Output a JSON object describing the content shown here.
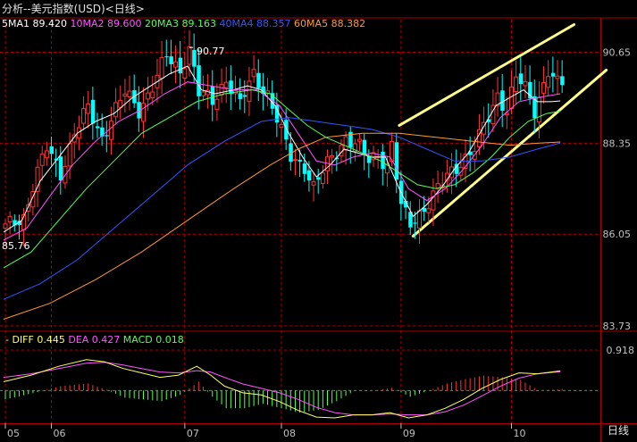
{
  "header": {
    "title": "分析--美元指数(USD)<日线>"
  },
  "ma_legend": [
    {
      "label": "5MA1",
      "value": "89.420",
      "color": "#ffffff"
    },
    {
      "label": "10MA2",
      "value": "89.600",
      "color": "#ff55ff"
    },
    {
      "label": "20MA3",
      "value": "89.163",
      "color": "#55ff55"
    },
    {
      "label": "40MA4",
      "value": "88.357",
      "color": "#3355ff"
    },
    {
      "label": "60MA5",
      "value": "88.382",
      "color": "#ff9933"
    }
  ],
  "macd_legend": [
    {
      "label": "DIFF",
      "value": "0.445",
      "color": "#ffff66"
    },
    {
      "label": "DEA",
      "value": "0.427",
      "color": "#ff55ff"
    },
    {
      "label": "MACD",
      "value": "0.018",
      "color": "#55ff55"
    }
  ],
  "period_label": "日线",
  "colors": {
    "up": "#ff3333",
    "down": "#00ffff",
    "grid": "#aa0000",
    "axis_text": "#c0c0c0",
    "trendline": "#ffff88"
  },
  "chart_data": [
    {
      "type": "candlestick",
      "name": "price",
      "ylim": [
        83.73,
        91.0
      ],
      "y_ticks": [
        "90.65",
        "88.35",
        "86.05",
        "83.73"
      ],
      "y_tick_values": [
        90.65,
        88.35,
        86.05,
        83.73
      ],
      "x_ticks": [
        "05",
        "06",
        "07",
        "08",
        "09",
        "10"
      ],
      "x_tick_index": [
        0,
        10,
        39,
        60,
        86,
        110
      ],
      "annotations": [
        {
          "text": "90.77",
          "index": 40,
          "value": 90.77
        },
        {
          "text": "85.76",
          "index": 0,
          "value": 85.76
        }
      ],
      "close_path": [
        [
          0,
          86.2
        ],
        [
          4,
          86.5
        ],
        [
          6,
          87.3
        ],
        [
          9,
          88.2
        ],
        [
          12,
          87.6
        ],
        [
          15,
          88.6
        ],
        [
          18,
          89.2
        ],
        [
          21,
          88.5
        ],
        [
          23,
          89.0
        ],
        [
          26,
          89.6
        ],
        [
          29,
          89.2
        ],
        [
          32,
          89.8
        ],
        [
          35,
          90.5
        ],
        [
          38,
          90.2
        ],
        [
          40,
          90.77
        ],
        [
          42,
          89.6
        ],
        [
          45,
          89.4
        ],
        [
          48,
          90.0
        ],
        [
          51,
          89.3
        ],
        [
          54,
          90.1
        ],
        [
          57,
          89.6
        ],
        [
          60,
          88.6
        ],
        [
          62,
          88.0
        ],
        [
          65,
          87.8
        ],
        [
          67,
          87.2
        ],
        [
          69,
          87.6
        ],
        [
          71,
          88.0
        ],
        [
          74,
          88.5
        ],
        [
          77,
          88.2
        ],
        [
          79,
          87.9
        ],
        [
          81,
          88.1
        ],
        [
          83,
          87.8
        ],
        [
          84,
          88.3
        ],
        [
          86,
          86.7
        ],
        [
          88,
          86.3
        ],
        [
          90,
          86.6
        ],
        [
          93,
          87.0
        ],
        [
          96,
          87.5
        ],
        [
          99,
          87.9
        ],
        [
          102,
          88.2
        ],
        [
          105,
          89.0
        ],
        [
          107,
          89.6
        ],
        [
          109,
          89.2
        ],
        [
          111,
          90.0
        ],
        [
          113,
          89.7
        ],
        [
          115,
          89.2
        ],
        [
          118,
          90.2
        ],
        [
          120,
          89.8
        ]
      ],
      "ma_series": [
        {
          "name": "5MA1",
          "color": "#ffffff",
          "values": [
            [
              0,
              86.1
            ],
            [
              4,
              86.4
            ],
            [
              8,
              87.4
            ],
            [
              12,
              88.0
            ],
            [
              16,
              88.6
            ],
            [
              20,
              88.9
            ],
            [
              24,
              89.1
            ],
            [
              28,
              89.5
            ],
            [
              32,
              89.8
            ],
            [
              36,
              90.1
            ],
            [
              40,
              90.3
            ],
            [
              43,
              89.7
            ],
            [
              46,
              89.6
            ],
            [
              50,
              89.7
            ],
            [
              53,
              89.8
            ],
            [
              56,
              89.7
            ],
            [
              59,
              89.3
            ],
            [
              62,
              88.6
            ],
            [
              65,
              88.0
            ],
            [
              68,
              87.5
            ],
            [
              71,
              87.8
            ],
            [
              74,
              88.2
            ],
            [
              77,
              88.1
            ],
            [
              80,
              88.0
            ],
            [
              83,
              88.0
            ],
            [
              86,
              87.2
            ],
            [
              89,
              86.5
            ],
            [
              92,
              86.8
            ],
            [
              95,
              87.2
            ],
            [
              98,
              87.7
            ],
            [
              101,
              88.1
            ],
            [
              104,
              88.7
            ],
            [
              107,
              89.3
            ],
            [
              110,
              89.5
            ],
            [
              113,
              89.7
            ],
            [
              116,
              89.4
            ],
            [
              119,
              89.4
            ],
            [
              121,
              89.42
            ]
          ]
        },
        {
          "name": "10MA2",
          "color": "#ff55ff",
          "values": [
            [
              0,
              85.9
            ],
            [
              5,
              86.2
            ],
            [
              10,
              87.0
            ],
            [
              15,
              87.8
            ],
            [
              20,
              88.4
            ],
            [
              25,
              88.9
            ],
            [
              30,
              89.2
            ],
            [
              35,
              89.6
            ],
            [
              40,
              89.9
            ],
            [
              45,
              89.8
            ],
            [
              50,
              89.7
            ],
            [
              55,
              89.7
            ],
            [
              60,
              89.3
            ],
            [
              64,
              88.6
            ],
            [
              68,
              87.9
            ],
            [
              72,
              87.8
            ],
            [
              76,
              88.0
            ],
            [
              80,
              88.1
            ],
            [
              84,
              88.0
            ],
            [
              88,
              87.2
            ],
            [
              92,
              86.9
            ],
            [
              96,
              87.2
            ],
            [
              100,
              87.7
            ],
            [
              104,
              88.3
            ],
            [
              108,
              89.0
            ],
            [
              112,
              89.4
            ],
            [
              116,
              89.5
            ],
            [
              121,
              89.6
            ]
          ]
        },
        {
          "name": "20MA3",
          "color": "#55ff55",
          "values": [
            [
              0,
              85.2
            ],
            [
              6,
              85.6
            ],
            [
              12,
              86.4
            ],
            [
              18,
              87.2
            ],
            [
              24,
              87.9
            ],
            [
              30,
              88.6
            ],
            [
              36,
              89.0
            ],
            [
              42,
              89.4
            ],
            [
              48,
              89.6
            ],
            [
              54,
              89.7
            ],
            [
              58,
              89.6
            ],
            [
              62,
              89.2
            ],
            [
              66,
              88.8
            ],
            [
              70,
              88.5
            ],
            [
              74,
              88.3
            ],
            [
              78,
              88.1
            ],
            [
              82,
              87.9
            ],
            [
              86,
              87.6
            ],
            [
              90,
              87.3
            ],
            [
              94,
              87.2
            ],
            [
              98,
              87.3
            ],
            [
              102,
              87.6
            ],
            [
              106,
              88.0
            ],
            [
              110,
              88.5
            ],
            [
              114,
              88.9
            ],
            [
              118,
              89.1
            ],
            [
              121,
              89.163
            ]
          ]
        },
        {
          "name": "40MA4",
          "color": "#3355ff",
          "values": [
            [
              0,
              84.4
            ],
            [
              8,
              84.8
            ],
            [
              16,
              85.4
            ],
            [
              24,
              86.2
            ],
            [
              32,
              87.0
            ],
            [
              40,
              87.8
            ],
            [
              48,
              88.4
            ],
            [
              56,
              88.9
            ],
            [
              62,
              89.0
            ],
            [
              68,
              88.9
            ],
            [
              74,
              88.8
            ],
            [
              80,
              88.7
            ],
            [
              86,
              88.5
            ],
            [
              92,
              88.2
            ],
            [
              98,
              87.9
            ],
            [
              104,
              87.9
            ],
            [
              110,
              88.0
            ],
            [
              116,
              88.2
            ],
            [
              121,
              88.357
            ]
          ]
        },
        {
          "name": "60MA5",
          "color": "#ff9933",
          "values": [
            [
              0,
              83.9
            ],
            [
              10,
              84.3
            ],
            [
              20,
              84.9
            ],
            [
              30,
              85.6
            ],
            [
              40,
              86.4
            ],
            [
              50,
              87.2
            ],
            [
              58,
              87.8
            ],
            [
              64,
              88.2
            ],
            [
              70,
              88.5
            ],
            [
              78,
              88.6
            ],
            [
              86,
              88.6
            ],
            [
              94,
              88.5
            ],
            [
              102,
              88.4
            ],
            [
              110,
              88.3
            ],
            [
              116,
              88.35
            ],
            [
              121,
              88.382
            ]
          ]
        }
      ],
      "trendlines": [
        {
          "from": [
            86,
            88.8
          ],
          "to": [
            124,
            91.35
          ]
        },
        {
          "from": [
            89,
            86.0
          ],
          "to": [
            131,
            90.2
          ]
        }
      ]
    },
    {
      "type": "macd",
      "name": "macd",
      "ylim": [
        -0.7,
        0.918
      ],
      "y_ticks": [
        "0.918"
      ],
      "y_tick_values": [
        0.918
      ],
      "diff": [
        [
          0,
          0.2
        ],
        [
          6,
          0.35
        ],
        [
          12,
          0.55
        ],
        [
          18,
          0.7
        ],
        [
          22,
          0.65
        ],
        [
          26,
          0.5
        ],
        [
          30,
          0.4
        ],
        [
          34,
          0.3
        ],
        [
          38,
          0.35
        ],
        [
          42,
          0.55
        ],
        [
          45,
          0.35
        ],
        [
          48,
          0.1
        ],
        [
          52,
          -0.05
        ],
        [
          56,
          -0.1
        ],
        [
          60,
          -0.25
        ],
        [
          64,
          -0.45
        ],
        [
          68,
          -0.6
        ],
        [
          72,
          -0.62
        ],
        [
          76,
          -0.55
        ],
        [
          80,
          -0.55
        ],
        [
          84,
          -0.5
        ],
        [
          88,
          -0.62
        ],
        [
          92,
          -0.55
        ],
        [
          96,
          -0.4
        ],
        [
          100,
          -0.2
        ],
        [
          104,
          0.05
        ],
        [
          108,
          0.25
        ],
        [
          112,
          0.4
        ],
        [
          116,
          0.38
        ],
        [
          121,
          0.445
        ]
      ],
      "dea": [
        [
          0,
          0.3
        ],
        [
          6,
          0.38
        ],
        [
          12,
          0.5
        ],
        [
          18,
          0.62
        ],
        [
          22,
          0.64
        ],
        [
          26,
          0.58
        ],
        [
          30,
          0.5
        ],
        [
          34,
          0.42
        ],
        [
          38,
          0.4
        ],
        [
          42,
          0.45
        ],
        [
          45,
          0.42
        ],
        [
          48,
          0.3
        ],
        [
          52,
          0.15
        ],
        [
          56,
          0.05
        ],
        [
          60,
          -0.05
        ],
        [
          64,
          -0.2
        ],
        [
          68,
          -0.38
        ],
        [
          72,
          -0.5
        ],
        [
          76,
          -0.55
        ],
        [
          80,
          -0.55
        ],
        [
          84,
          -0.53
        ],
        [
          88,
          -0.55
        ],
        [
          92,
          -0.55
        ],
        [
          96,
          -0.48
        ],
        [
          100,
          -0.33
        ],
        [
          104,
          -0.12
        ],
        [
          108,
          0.1
        ],
        [
          112,
          0.28
        ],
        [
          116,
          0.38
        ],
        [
          121,
          0.427
        ]
      ]
    }
  ]
}
